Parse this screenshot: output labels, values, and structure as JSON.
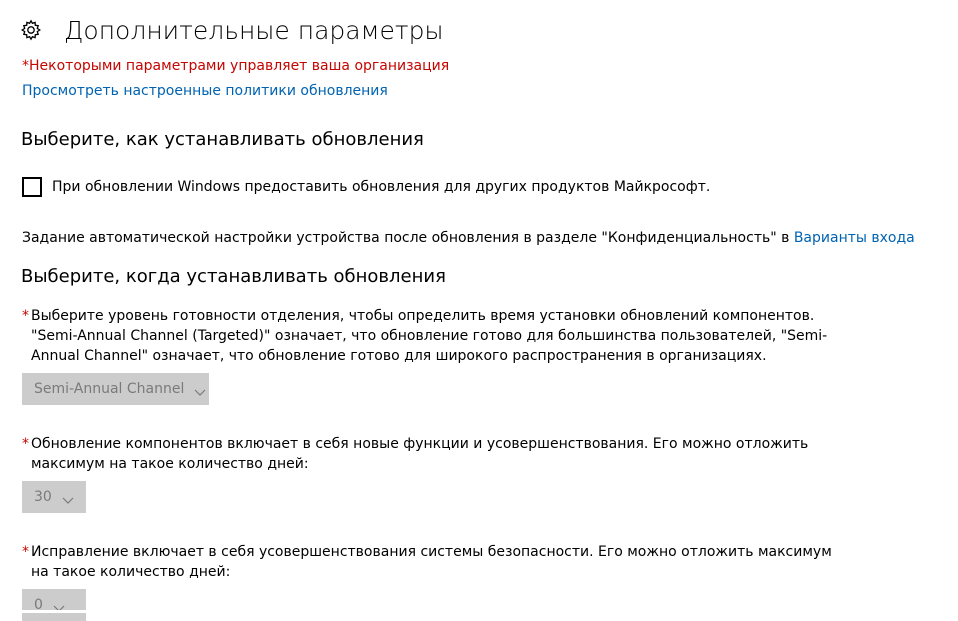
{
  "header": {
    "title": "Дополнительные параметры",
    "icon": "gear-icon"
  },
  "notice": {
    "managed": "*Некоторыми параметрами управляет ваша организация",
    "view_policies_link": "Просмотреть настроенные политики обновления"
  },
  "install_how": {
    "title": "Выберите, как устанавливать обновления",
    "checkbox_label": "При обновлении Windows предоставить обновления для других продуктов Майкрософт.",
    "checkbox_checked": false,
    "privacy_text": "Задание автоматической настройки устройства после обновления в разделе \"Конфиденциальность\" в ",
    "privacy_link": "Варианты входа"
  },
  "install_when": {
    "title": "Выберите, когда устанавливать обновления",
    "branch": {
      "star": "*",
      "text": "Выберите уровень готовности отделения, чтобы определить время установки обновлений компонентов. \"Semi-Annual Channel (Targeted)\" означает, что обновление готово для большинства пользователей, \"Semi-Annual Channel\" означает, что обновление готово для широкого распространения в организациях.",
      "selected": "Semi-Annual Channel"
    },
    "feature_defer": {
      "star": "*",
      "text": "Обновление компонентов включает в себя новые функции и усовершенствования. Его можно отложить максимум на такое количество дней:",
      "selected": "30"
    },
    "quality_defer": {
      "star": "*",
      "text": "Исправление включает в себя усовершенствования системы безопасности. Его можно отложить максимум на такое количество дней:",
      "selected": "0"
    }
  },
  "colors": {
    "accent_link": "#0063b1",
    "warning": "#c50500",
    "disabled_bg": "#cccccc",
    "disabled_text": "#7a7a7a"
  }
}
